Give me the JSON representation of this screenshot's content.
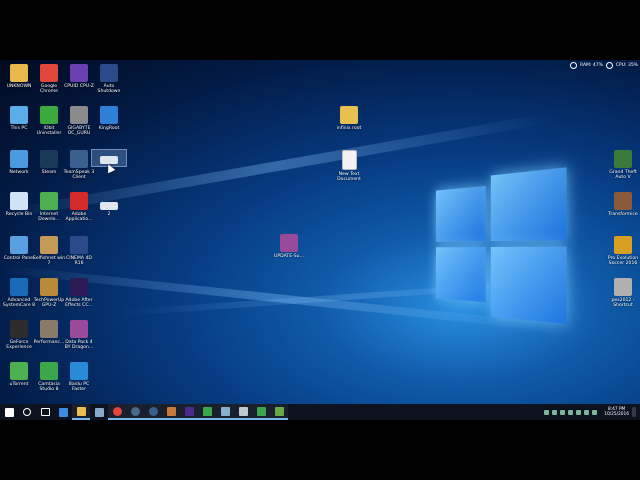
{
  "status_overlay": {
    "ram": "RAM: 47%",
    "cpu": "CPU: 35%"
  },
  "desktop_icons": [
    {
      "id": "unknown",
      "label": "UNKNOWN",
      "icon": "folder-icon",
      "color": "#e8b84a"
    },
    {
      "id": "chrome",
      "label": "Google Chrome",
      "icon": "chrome-icon",
      "color": "#e0463a"
    },
    {
      "id": "cpuz",
      "label": "CPUID CPU-Z",
      "icon": "cpu-icon",
      "color": "#6a3fb2"
    },
    {
      "id": "autoshutdown",
      "label": "Auto Shutdown",
      "icon": "power-icon",
      "color": "#2c4a8a"
    },
    {
      "id": "thispc",
      "label": "This PC",
      "icon": "computer-icon",
      "color": "#5aaee8"
    },
    {
      "id": "iobit",
      "label": "IObit Uninstaller",
      "icon": "uninstaller-icon",
      "color": "#3da83d"
    },
    {
      "id": "gigabyte",
      "label": "GIGABYTE OC_GURU",
      "icon": "gigabyte-icon",
      "color": "#8a8a8a"
    },
    {
      "id": "kingroot",
      "label": "KingRoot",
      "icon": "kingroot-icon",
      "color": "#2f7fd8"
    },
    {
      "id": "network",
      "label": "Network",
      "icon": "network-icon",
      "color": "#4a9ae0"
    },
    {
      "id": "steam",
      "label": "Steam",
      "icon": "steam-icon",
      "color": "#1b3a5a"
    },
    {
      "id": "teamspeak",
      "label": "TeamSpeak 3 Client",
      "icon": "teamspeak-icon",
      "color": "#3a5f8f"
    },
    {
      "id": "selected-shortcut",
      "label": "",
      "icon": "shortcut-icon",
      "color": "#dfe6ee"
    },
    {
      "id": "recycle",
      "label": "Recycle Bin",
      "icon": "recycle-bin-icon",
      "color": "#cfe3f5"
    },
    {
      "id": "ie",
      "label": "Internet Downlo...",
      "icon": "download-icon",
      "color": "#4caf50"
    },
    {
      "id": "adobeapp",
      "label": "Adobe Applicatio...",
      "icon": "adobe-icon",
      "color": "#d42a2a"
    },
    {
      "id": "two",
      "label": "2",
      "icon": "shortcut-icon",
      "color": "#dfe6ee"
    },
    {
      "id": "controlpanel",
      "label": "Control Panel",
      "icon": "control-panel-icon",
      "color": "#5aa0e0"
    },
    {
      "id": "selfishnet",
      "label": "Selfishnet win 7",
      "icon": "archive-icon",
      "color": "#c49a5a"
    },
    {
      "id": "cinema4d",
      "label": "CINEMA 4D R16",
      "icon": "cinema4d-icon",
      "color": "#2a4a8a"
    },
    {
      "id": "advsyscare",
      "label": "Advanced SystemCare 8",
      "icon": "systemcare-icon",
      "color": "#1a6ab8"
    },
    {
      "id": "techpowerup",
      "label": "TechPowerUp GPU-Z",
      "icon": "gpuz-icon",
      "color": "#b88a3a"
    },
    {
      "id": "aftereffects",
      "label": "Adobe After Effects CC...",
      "icon": "after-effects-icon",
      "color": "#2b1a55"
    },
    {
      "id": "geforce",
      "label": "GeForce Experience",
      "icon": "geforce-icon",
      "color": "#2c2c2c"
    },
    {
      "id": "performance",
      "label": "Performanc...",
      "icon": "performance-icon",
      "color": "#8a7a6a"
    },
    {
      "id": "datapack",
      "label": "Data Pack 4 BY Dragon...",
      "icon": "winrar-icon",
      "color": "#9a4a9a"
    },
    {
      "id": "utorrent",
      "label": "uTorrent",
      "icon": "utorrent-icon",
      "color": "#4caf50"
    },
    {
      "id": "camtasia",
      "label": "Camtasia Studio 8",
      "icon": "camtasia-icon",
      "color": "#3aa84a"
    },
    {
      "id": "baidu",
      "label": "Baidu PC Faster",
      "icon": "baidu-icon",
      "color": "#2a8ad8"
    },
    {
      "id": "infinix",
      "label": "infinix root",
      "icon": "folder-icon",
      "color": "#e8c050"
    },
    {
      "id": "newtext",
      "label": "New Text Document",
      "icon": "text-document-icon",
      "color": "#f2f2f2"
    },
    {
      "id": "update",
      "label": "UPDATE-Su...",
      "icon": "winrar-icon",
      "color": "#9a4a9a"
    },
    {
      "id": "gta",
      "label": "Grand Theft Auto V",
      "icon": "gta-icon",
      "color": "#3a7a3a"
    },
    {
      "id": "teamformice",
      "label": "Transformice",
      "icon": "transformice-icon",
      "color": "#8a5a3a"
    },
    {
      "id": "pes",
      "label": "Pro Evolution Soccer 2016",
      "icon": "pes-icon",
      "color": "#d8a020"
    },
    {
      "id": "pes2012",
      "label": "pes2012 - Shortcut",
      "icon": "pes-icon",
      "color": "#b0b0b0"
    }
  ],
  "taskbar": {
    "items": [
      {
        "icon": "start-icon",
        "color": "#ffffff"
      },
      {
        "icon": "search-icon",
        "color": "#ffffff"
      },
      {
        "icon": "task-view-icon",
        "color": "#ffffff"
      },
      {
        "icon": "edge-icon",
        "color": "#3a8de0"
      },
      {
        "icon": "file-explorer-icon",
        "color": "#e8c050"
      },
      {
        "icon": "store-icon",
        "color": "#8aa8c8"
      },
      {
        "icon": "chrome-icon",
        "color": "#e0463a"
      },
      {
        "icon": "steam-icon",
        "color": "#4a6a8a"
      },
      {
        "icon": "teamspeak-icon",
        "color": "#3a5f8f"
      },
      {
        "icon": "app-icon",
        "color": "#c87a3a"
      },
      {
        "icon": "after-effects-icon",
        "color": "#4a2a8a"
      },
      {
        "icon": "camtasia-icon",
        "color": "#3aa84a"
      },
      {
        "icon": "window-icon",
        "color": "#8ab0d0"
      },
      {
        "icon": "window-icon",
        "color": "#c0c8d0"
      },
      {
        "icon": "camtasia-icon",
        "color": "#3aa84a"
      },
      {
        "icon": "app-icon",
        "color": "#6aa84a"
      }
    ],
    "clock": {
      "time": "8:47 PM",
      "date": "10/25/2016"
    }
  }
}
